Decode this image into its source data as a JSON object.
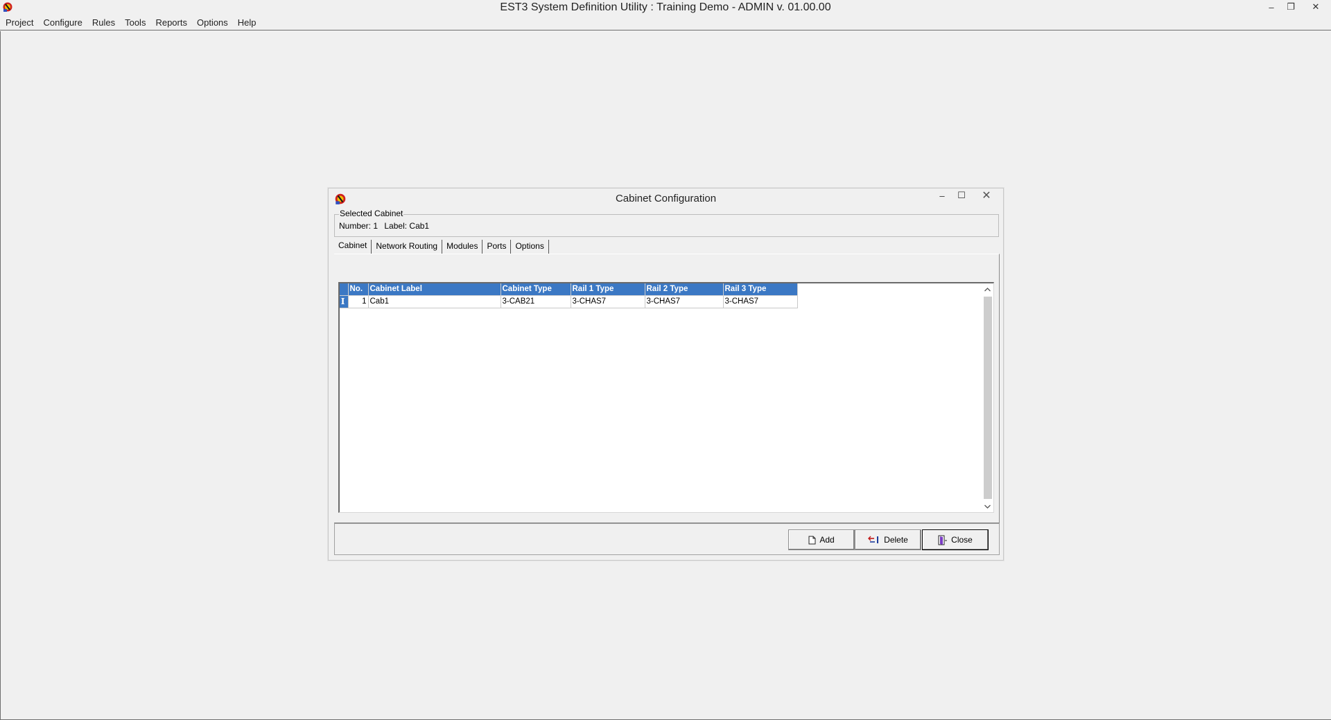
{
  "app": {
    "title": "EST3 System Definition Utility : Training Demo - ADMIN v. 01.00.00"
  },
  "window_controls": {
    "minimize": "–",
    "restore": "❐",
    "close": "✕"
  },
  "menu": [
    "Project",
    "Configure",
    "Rules",
    "Tools",
    "Reports",
    "Options",
    "Help"
  ],
  "dialog": {
    "title": "Cabinet Configuration",
    "controls": {
      "minimize": "–",
      "maximize": "☐",
      "close": "✕"
    },
    "selected_cabinet": {
      "legend": "Selected Cabinet",
      "number_text": "Number: 1",
      "label_text": "Label: Cab1"
    },
    "tabs": [
      {
        "label": "Cabinet",
        "active": true
      },
      {
        "label": "Network Routing",
        "active": false
      },
      {
        "label": "Modules",
        "active": false
      },
      {
        "label": "Ports",
        "active": false
      },
      {
        "label": "Options",
        "active": false
      }
    ],
    "grid": {
      "columns": [
        "No.",
        "Cabinet Label",
        "Cabinet Type",
        "Rail 1 Type",
        "Rail 2 Type",
        "Rail 3 Type"
      ],
      "rows": [
        {
          "no": "1",
          "label": "Cab1",
          "type": "3-CAB21",
          "rail1": "3-CHAS7",
          "rail2": "3-CHAS7",
          "rail3": "3-CHAS7"
        }
      ],
      "edit_indicator": "I"
    },
    "buttons": {
      "add": "Add",
      "delete": "Delete",
      "close": "Close"
    }
  },
  "colors": {
    "grid_header": "#3b78c4",
    "background": "#f0f0f0"
  }
}
